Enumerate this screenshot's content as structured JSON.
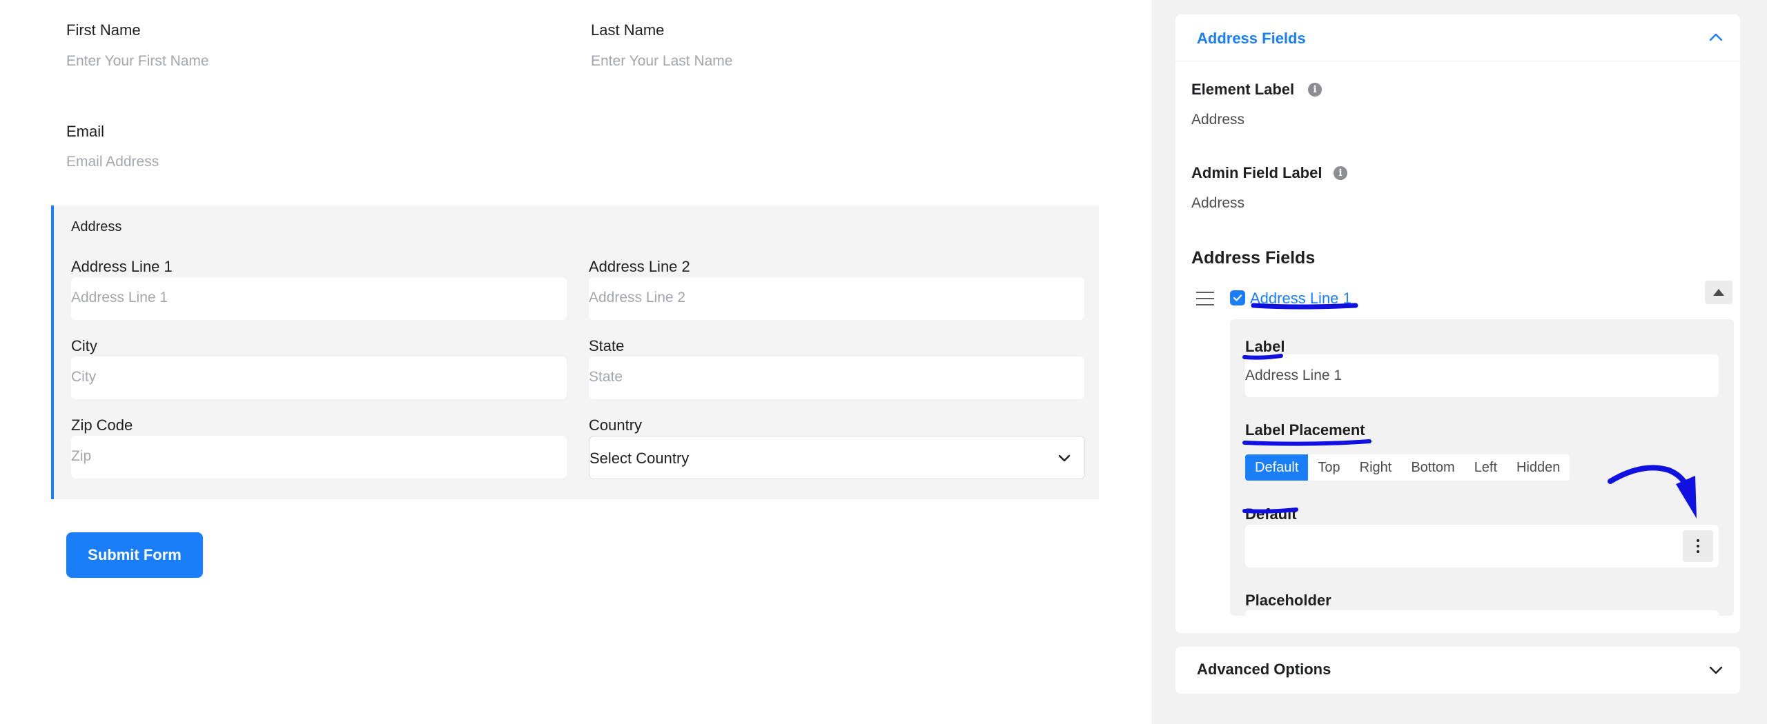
{
  "form": {
    "first_name": {
      "label": "First Name",
      "placeholder": "Enter Your First Name"
    },
    "last_name": {
      "label": "Last Name",
      "placeholder": "Enter Your Last Name"
    },
    "email": {
      "label": "Email",
      "placeholder": "Email Address"
    },
    "address": {
      "title": "Address",
      "line1": {
        "label": "Address Line 1",
        "placeholder": "Address Line 1"
      },
      "line2": {
        "label": "Address Line 2",
        "placeholder": "Address Line 2"
      },
      "city": {
        "label": "City",
        "placeholder": "City"
      },
      "state": {
        "label": "State",
        "placeholder": "State"
      },
      "zip": {
        "label": "Zip Code",
        "placeholder": "Zip"
      },
      "country": {
        "label": "Country",
        "selected": "Select Country"
      }
    },
    "submit_label": "Submit Form"
  },
  "panel": {
    "section_title": "Address Fields",
    "element_label": {
      "label": "Element Label",
      "value": "Address"
    },
    "admin_label": {
      "label": "Admin Field Label",
      "value": "Address"
    },
    "fields_title": "Address Fields",
    "item": {
      "name": "Address Line 1",
      "checked": true,
      "label_heading": "Label",
      "label_value": "Address Line 1",
      "placement_heading": "Label Placement",
      "placement_options": [
        "Default",
        "Top",
        "Right",
        "Bottom",
        "Left",
        "Hidden"
      ],
      "placement_selected": "Default",
      "default_heading": "Default",
      "default_value": "",
      "placeholder_heading": "Placeholder"
    },
    "advanced_title": "Advanced Options"
  },
  "colors": {
    "accent": "#1a7efb",
    "annotation": "#1010e0"
  },
  "icons": [
    "info-icon",
    "drag-handle-icon",
    "checkbox-icon",
    "chevron-up-icon",
    "chevron-down-icon",
    "caret-up-icon",
    "more-vertical-icon",
    "arrow-annotation-icon"
  ]
}
